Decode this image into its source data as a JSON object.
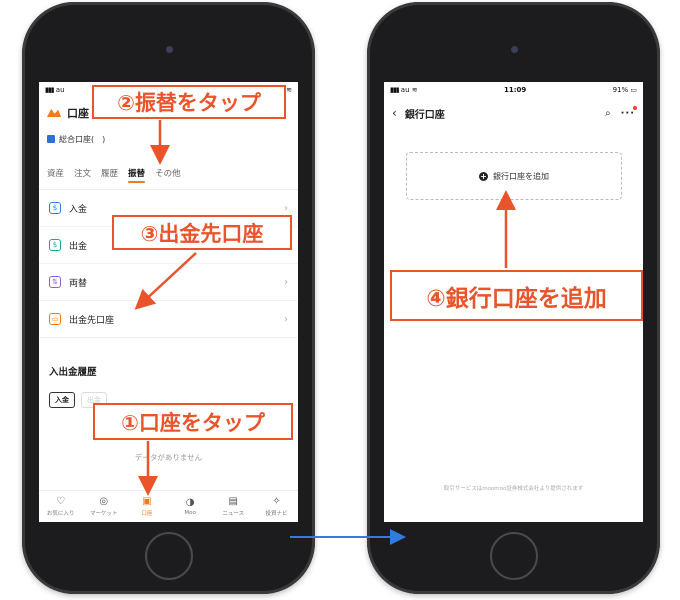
{
  "left_screen": {
    "status": {
      "carrier": "au",
      "signal_text": "▮▮▮"
    },
    "header": {
      "title": "口座"
    },
    "account": {
      "label": "総合口座(　)"
    },
    "tabs": [
      {
        "label": "資産"
      },
      {
        "label": "注文"
      },
      {
        "label": "履歴"
      },
      {
        "label": "振替"
      },
      {
        "label": "その他"
      }
    ],
    "menu": [
      {
        "icon": "$",
        "label": "入金"
      },
      {
        "icon": "$",
        "label": "出金"
      },
      {
        "icon": "⇅",
        "label": "両替"
      },
      {
        "icon": "▭",
        "label": "出金先口座"
      }
    ],
    "history": {
      "title": "入出金履歴",
      "chip_active": "入金",
      "chip_inactive": "出金",
      "empty": "データがありません"
    },
    "bottom_nav": [
      {
        "icon": "♡",
        "label": "お気に入り"
      },
      {
        "icon": "◎",
        "label": "マーケット"
      },
      {
        "icon": "▣",
        "label": "口座"
      },
      {
        "icon": "◑",
        "label": "Moo"
      },
      {
        "icon": "▤",
        "label": "ニュース"
      },
      {
        "icon": "✧",
        "label": "投資ナビ"
      }
    ]
  },
  "right_screen": {
    "status": {
      "carrier": "au",
      "time": "11:09",
      "battery": "91%"
    },
    "header": {
      "title": "銀行口座"
    },
    "add_bank_label": "銀行口座を追加",
    "footer_note": "取引サービスはmoomoo証券株式会社より提供されます"
  },
  "annotations": {
    "step1": "①口座をタップ",
    "step2": "②振替をタップ",
    "step3": "③出金先口座",
    "step4": "④銀行口座を追加"
  },
  "colors": {
    "accent": "#f07d1c",
    "annotation": "#e9542b",
    "link_arrow": "#2f7de1"
  }
}
